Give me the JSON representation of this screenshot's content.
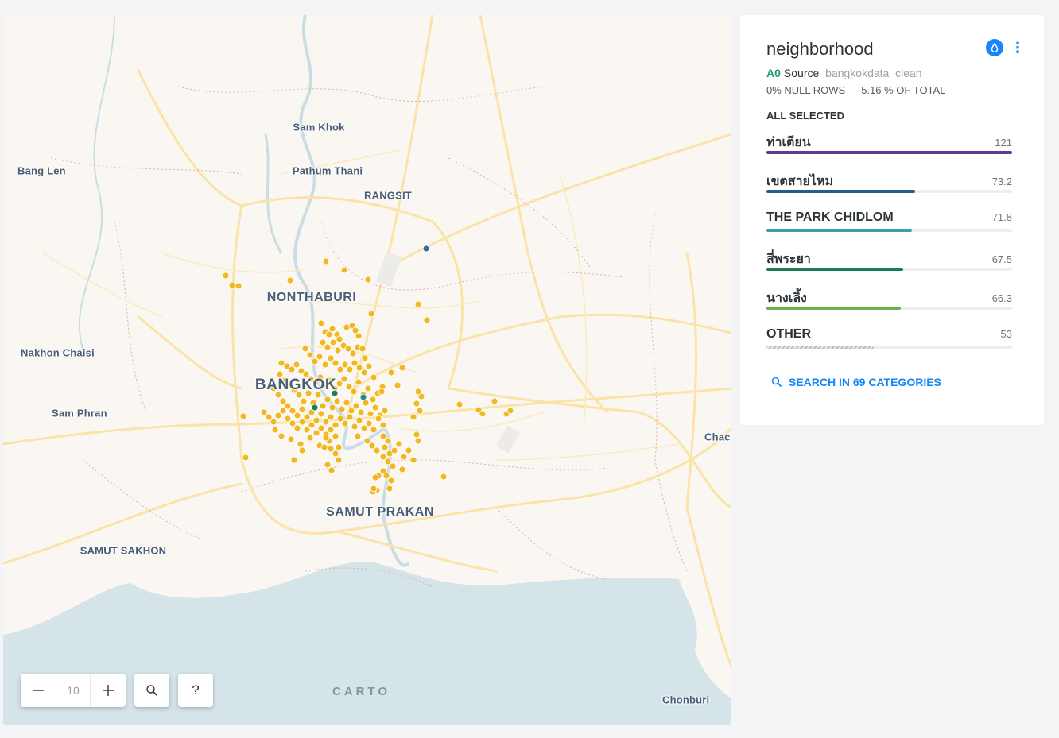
{
  "map": {
    "zoom_level": "10",
    "attribution": "CARTO",
    "places": [
      {
        "name": "Sam Khok",
        "cls": "small"
      },
      {
        "name": "Bang Len",
        "cls": "small"
      },
      {
        "name": "Pathum Thani",
        "cls": "small"
      },
      {
        "name": "RANGSIT",
        "cls": "small"
      },
      {
        "name": "NONTHABURI",
        "cls": "mid"
      },
      {
        "name": "Nakhon Chaisi",
        "cls": "small"
      },
      {
        "name": "BANGKOK",
        "cls": "big"
      },
      {
        "name": "Sam Phran",
        "cls": "small"
      },
      {
        "name": "Chac",
        "cls": "small"
      },
      {
        "name": "SAMUT PRAKAN",
        "cls": "mid"
      },
      {
        "name": "SAMUT SAKHON",
        "cls": "small"
      },
      {
        "name": "Chonburi",
        "cls": "small"
      }
    ],
    "colors": {
      "land": "#faf7f3",
      "water": "#d4e4e9",
      "road": "#fbe3a8",
      "boundary": "#e3aeae",
      "point_default": "#f0b418",
      "point_green": "#1a7d55",
      "point_teal": "#1f8d8a",
      "point_blue": "#316d9e"
    }
  },
  "widget": {
    "title": "neighborhood",
    "source_code": "A0",
    "source_label": "Source",
    "source_name": "bangkokdata_clean",
    "null_rows": "0% NULL ROWS",
    "total_pct": "5.16 % OF TOTAL",
    "selection_label": "ALL SELECTED",
    "categories": [
      {
        "label": "ท่าเตียน",
        "value": 121,
        "display": "121",
        "color": "#5b3f8d"
      },
      {
        "label": "เขตสายไหม",
        "value": 73.2,
        "display": "73.2",
        "color": "#215d8d"
      },
      {
        "label": "THE PARK CHIDLOM",
        "value": 71.8,
        "display": "71.8",
        "color": "#3aa1a4"
      },
      {
        "label": "สี่พระยา",
        "value": 67.5,
        "display": "67.5",
        "color": "#1a7d55"
      },
      {
        "label": "นางเลิ้ง",
        "value": 66.3,
        "display": "66.3",
        "color": "#6ab04c"
      },
      {
        "label": "OTHER",
        "value": 53,
        "display": "53",
        "color": "other"
      }
    ],
    "search_label": "SEARCH IN 69 CATEGORIES"
  }
}
